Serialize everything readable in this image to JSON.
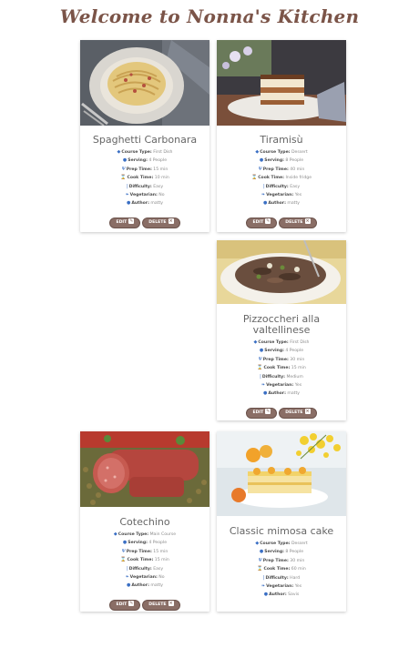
{
  "page": {
    "title": "Welcome to Nonna's Kitchen"
  },
  "labels": {
    "course": "Course Type:",
    "serving": "Serving:",
    "prep": "Prep Time:",
    "cook": "Cook Time:",
    "difficulty": "Difficulty:",
    "vegetarian": "Vegetarian:",
    "author": "Author:",
    "edit": "EDIT",
    "delete": "DELETE"
  },
  "recipes": [
    {
      "name": "Spaghetti Carbonara",
      "course": "First Dish",
      "serving": "4 People",
      "prep": "15 min",
      "cook": "10 min",
      "difficulty": "Easy",
      "vegetarian": "No",
      "author": "matty"
    },
    {
      "name": "Tiramisù",
      "course": "Dessert",
      "serving": "8 People",
      "prep": "40 min",
      "cook": "Inside fridge",
      "difficulty": "Easy",
      "vegetarian": "Yes",
      "author": "matty"
    },
    {
      "name": "Pizzoccheri alla valtellinese",
      "course": "First Dish",
      "serving": "4 People",
      "prep": "30 min",
      "cook": "15 min",
      "difficulty": "Medium",
      "vegetarian": "Yes",
      "author": "matty"
    },
    {
      "name": "Cotechino",
      "course": "Main Course",
      "serving": "4 People",
      "prep": "15 min",
      "cook": "15 min",
      "difficulty": "Easy",
      "vegetarian": "No",
      "author": "matty"
    },
    {
      "name": "Classic mimosa cake",
      "course": "Dessert",
      "serving": "8 People",
      "prep": "30 min",
      "cook": "60 min",
      "difficulty": "Hard",
      "vegetarian": "Yes",
      "author": "Savis"
    }
  ]
}
